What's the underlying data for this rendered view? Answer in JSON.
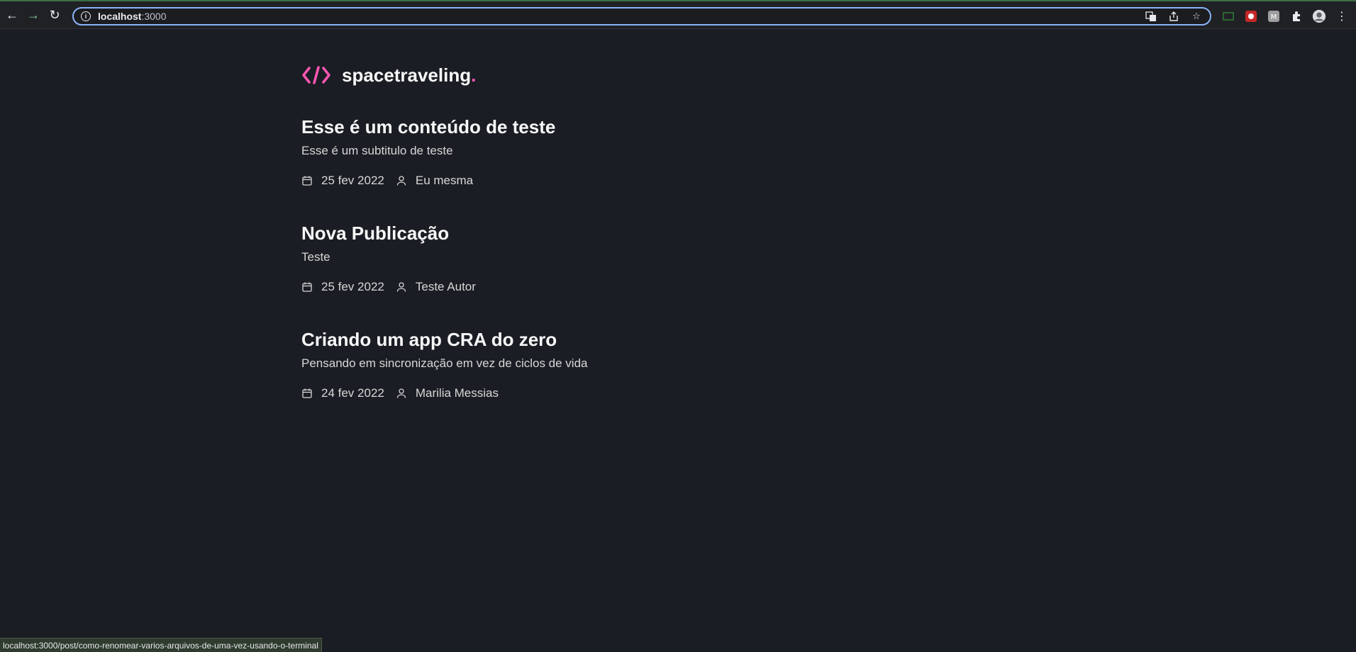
{
  "browser": {
    "url_host": "localhost",
    "url_port": ":3000",
    "status_url": "localhost:3000/post/como-renomear-varios-arquivos-de-uma-vez-usando-o-terminal"
  },
  "logo": {
    "text": "spacetraveling",
    "dot": ".",
    "accent_color": "#ff57b2"
  },
  "posts": [
    {
      "title": "Esse é um conteúdo de teste",
      "subtitle": "Esse é um subtitulo de teste",
      "date": "25 fev 2022",
      "author": "Eu mesma"
    },
    {
      "title": "Nova Publicação",
      "subtitle": "Teste",
      "date": "25 fev 2022",
      "author": "Teste Autor"
    },
    {
      "title": "Criando um app CRA do zero",
      "subtitle": "Pensando em sincronização em vez de ciclos de vida",
      "date": "24 fev 2022",
      "author": "Marilia Messias"
    }
  ],
  "icons": {
    "date": "calendar-icon",
    "author": "user-icon"
  }
}
